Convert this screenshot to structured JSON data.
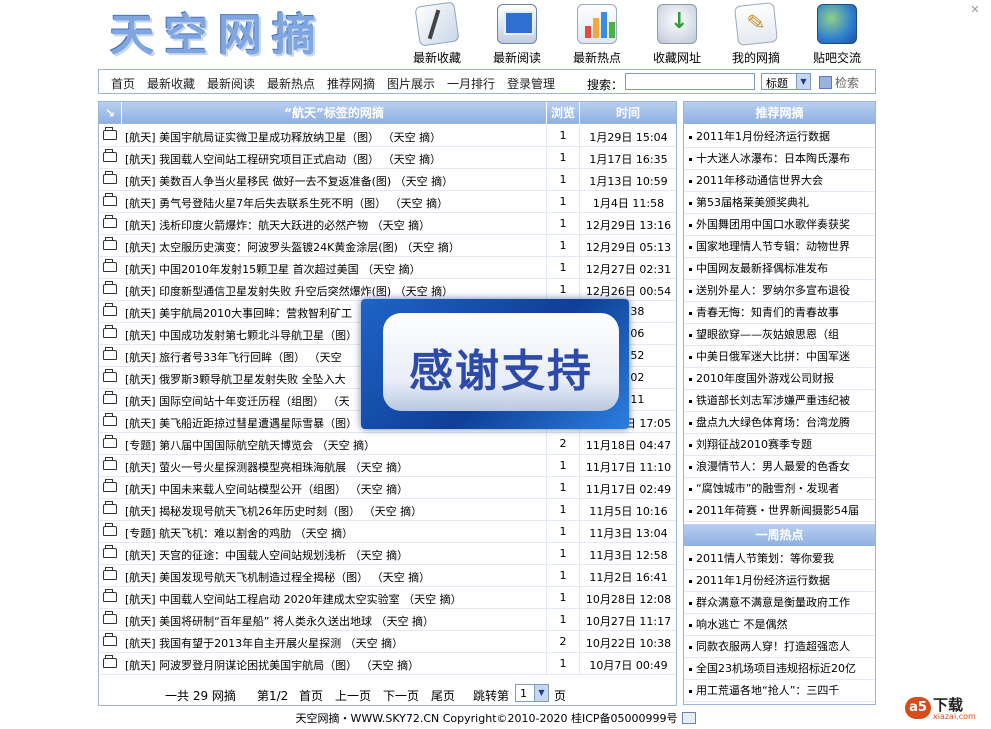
{
  "site": {
    "logo_text": "天空网摘",
    "close_glyph": "✕"
  },
  "top_nav": [
    {
      "label": "最新收藏",
      "icon": "document-pen-icon"
    },
    {
      "label": "最新阅读",
      "icon": "monitor-icon"
    },
    {
      "label": "最新热点",
      "icon": "bar-chart-icon"
    },
    {
      "label": "收藏网址",
      "icon": "inbox-download-icon"
    },
    {
      "label": "我的网摘",
      "icon": "notepad-icon"
    },
    {
      "label": "贴吧交流",
      "icon": "globe-icon"
    }
  ],
  "menu": [
    "首页",
    "最新收藏",
    "最新阅读",
    "最新热点",
    "推荐网摘",
    "图片展示",
    "一月排行",
    "登录管理"
  ],
  "search": {
    "label": "搜索：",
    "placeholder": "",
    "field_option": "标题",
    "button_label": "检索"
  },
  "table": {
    "corner_glyph": "↘",
    "header_title": "“航天”标签的网摘",
    "header_views": "浏览",
    "header_time": "时间",
    "rows": [
      {
        "title": "[航天] 美国宇航局证实微卫星成功释放纳卫星（图）",
        "author": "（天空 摘）",
        "views": "1",
        "time": "1月29日 15:04"
      },
      {
        "title": "[航天] 我国载人空间站工程研究项目正式启动（图）",
        "author": "（天空 摘）",
        "views": "1",
        "time": "1月17日 16:35"
      },
      {
        "title": "[航天] 美数百人争当火星移民 做好一去不复返准备(图)",
        "author": "（天空 摘）",
        "views": "1",
        "time": "1月13日 10:59"
      },
      {
        "title": "[航天] 勇气号登陆火星7年后失去联系生死不明（图）",
        "author": "（天空 摘）",
        "views": "1",
        "time": "1月4日 11:58"
      },
      {
        "title": "[航天] 浅析印度火箭爆炸：航天大跃进的必然产物",
        "author": "（天空 摘）",
        "views": "1",
        "time": "12月29日 13:16"
      },
      {
        "title": "[航天] 太空服历史演变：阿波罗头盔镀24K黄金涂层(图)",
        "author": "（天空 摘）",
        "views": "1",
        "time": "12月29日 05:13"
      },
      {
        "title": "[航天] 中国2010年发射15颗卫星 首次超过美国",
        "author": "（天空 摘）",
        "views": "1",
        "time": "12月27日 02:31"
      },
      {
        "title": "[航天] 印度新型通信卫星发射失败 升空后突然爆炸(图)",
        "author": "（天空 摘）",
        "views": "1",
        "time": "12月26日 00:54"
      },
      {
        "title": "[航天] 美宇航局2010大事回眸：营救智利矿工",
        "author": "",
        "views": "1",
        "time": "20:38"
      },
      {
        "title": "[航天] 中国成功发射第七颗北斗导航卫星（图）",
        "author": "",
        "views": "1",
        "time": "19:06"
      },
      {
        "title": "[航天] 旅行者号33年飞行回眸（图）",
        "author": "（天空",
        "views": "1",
        "time": "13:52"
      },
      {
        "title": "[航天] 俄罗斯3颗导航卫星发射失败 全坠入大",
        "author": "",
        "views": "1",
        "time": "08:02"
      },
      {
        "title": "[航天] 国际空间站十年变迁历程（组图）",
        "author": "（天",
        "views": "1",
        "time": "17:11"
      },
      {
        "title": "[航天] 美飞船近距掠过彗星遭遇星际雪暴（图）",
        "author": "（天空 摘）",
        "views": "1",
        "time": "11月22日 17:05"
      },
      {
        "title": "[专题] 第八届中国国际航空航天博览会",
        "author": "（天空 摘）",
        "views": "2",
        "time": "11月18日 04:47"
      },
      {
        "title": "[航天] 萤火一号火星探测器模型亮相珠海航展",
        "author": "（天空 摘）",
        "views": "1",
        "time": "11月17日 11:10"
      },
      {
        "title": "[航天] 中国未来载人空间站模型公开（组图）",
        "author": "（天空 摘）",
        "views": "1",
        "time": "11月17日 02:49"
      },
      {
        "title": "[航天] 揭秘发现号航天飞机26年历史时刻（图）",
        "author": "（天空 摘）",
        "views": "1",
        "time": "11月5日 10:16"
      },
      {
        "title": "[专题] 航天飞机：难以割舍的鸡肋",
        "author": "（天空 摘）",
        "views": "1",
        "time": "11月3日 13:04"
      },
      {
        "title": "[航天] 天宫的征途：中国载人空间站规划浅析",
        "author": "（天空 摘）",
        "views": "1",
        "time": "11月3日 12:58"
      },
      {
        "title": "[航天] 美国发现号航天飞机制造过程全揭秘（图）",
        "author": "（天空 摘）",
        "views": "1",
        "time": "11月2日 16:41"
      },
      {
        "title": "[航天] 中国载人空间站工程启动 2020年建成太空实验室",
        "author": "（天空 摘）",
        "views": "1",
        "time": "10月28日 12:08"
      },
      {
        "title": "[航天] 美国将研制“百年星船” 将人类永久送出地球",
        "author": "（天空 摘）",
        "views": "1",
        "time": "10月27日 11:17"
      },
      {
        "title": "[航天] 我国有望于2013年自主开展火星探测",
        "author": "（天空 摘）",
        "views": "2",
        "time": "10月22日 10:38"
      },
      {
        "title": "[航天] 阿波罗登月阴谋论困扰美国宇航局（图）",
        "author": "（天空 摘）",
        "views": "1",
        "time": "10月7日 00:49"
      }
    ]
  },
  "pager": {
    "total": "一共 29 网摘",
    "page": "第1/2",
    "first": "首页",
    "prev": "上一页",
    "next": "下一页",
    "last": "尾页",
    "jump_label": "跳转第",
    "jump_value": "1",
    "jump_suffix": "页"
  },
  "sidebar": {
    "recommend_title": "推荐网摘",
    "recommend": [
      "2011年1月份经济运行数据",
      "十大迷人冰瀑布：日本陶氏瀑布",
      "2011年移动通信世界大会",
      "第53届格莱美颁奖典礼",
      "外国舞团用中国口水歌伴奏获奖",
      "国家地理情人节专辑：动物世界",
      "中国网友最新择偶标准发布",
      "送别外星人：罗纳尔多宣布退役",
      "青春无悔：知青们的青春故事",
      "望眼欲穿——灰姑娘思恩（组",
      "中美日俄军迷大比拼：中国军迷",
      "2010年度国外游戏公司财报",
      "铁道部长刘志军涉嫌严重违纪被",
      "盘点九大绿色体育场：台湾龙腾",
      "刘翔征战2010赛季专题",
      "浪漫情节人：男人最爱的色香女",
      "“腐蚀城市”的融雪剂・发现者",
      "2011年荷赛・世界新闻摄影54届"
    ],
    "hot_title": "一周热点",
    "hot": [
      "2011情人节策划：等你爱我",
      "2011年1月份经济运行数据",
      "群众满意不满意是衡量政府工作",
      "响水逃亡 不是偶然",
      "同款衣服两人穿！打造超强恋人",
      "全国23机场项目违规招标近20亿",
      "用工荒逼各地“抢人”：三四千"
    ]
  },
  "overlay": {
    "text": "感谢支持"
  },
  "footer": {
    "text": "天空网摘・WWW.SKY72.CN Copyright©2010-2020 桂ICP备05000999号"
  },
  "badge": {
    "letter": "a5",
    "title": "下载",
    "domain": "xiazai.com"
  },
  "colors": {
    "accent": "#8eb0e3",
    "border": "#9bb5dd",
    "logo": "#7fa6df",
    "overlay_text": "#2d4aa8"
  }
}
